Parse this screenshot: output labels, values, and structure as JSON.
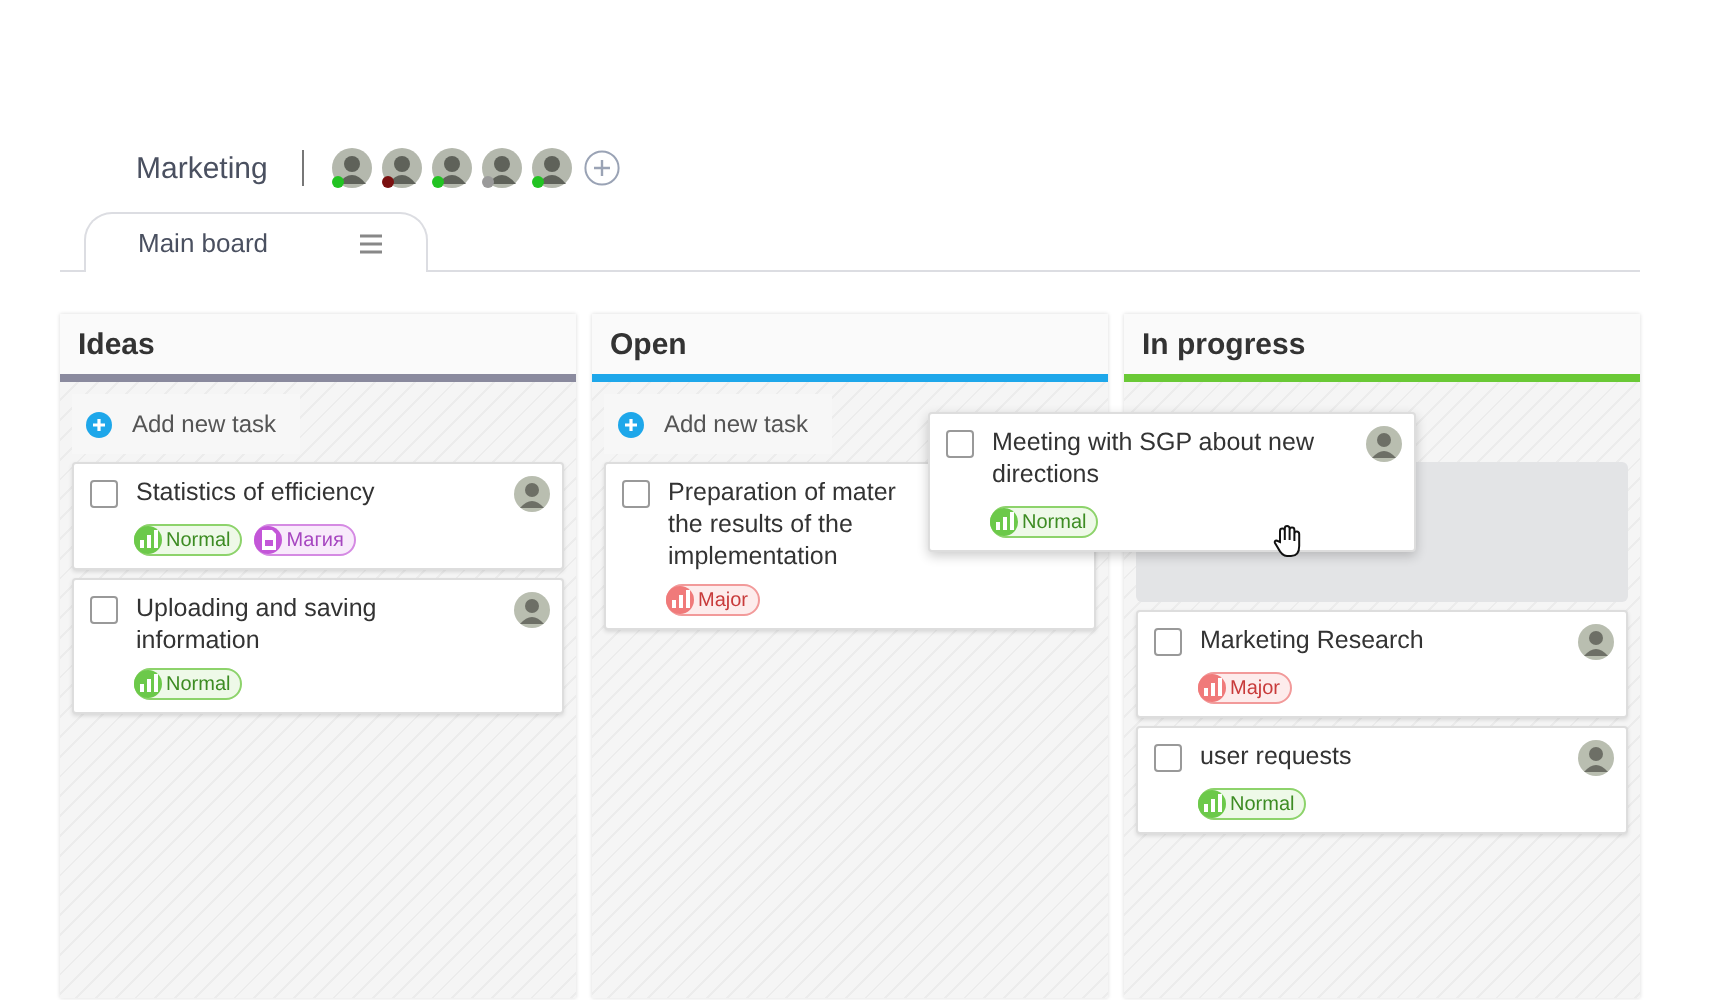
{
  "project": {
    "title": "Marketing",
    "members": [
      {
        "color": "#22c322"
      },
      {
        "color": "#7a1010"
      },
      {
        "color": "#22c322"
      },
      {
        "color": "#9a9a9a"
      },
      {
        "color": "#22c322"
      }
    ]
  },
  "tabs": [
    {
      "label": "Main board",
      "selected": true
    }
  ],
  "columns": [
    {
      "title": "Ideas",
      "color": "#8a8a9e",
      "add_label": "Add new task",
      "items": [
        {
          "kind": "card",
          "title": "Statistics of efficiency",
          "checked": false,
          "tags": [
            {
              "kind": "normal",
              "label": "Normal"
            },
            {
              "kind": "label",
              "label": "Магия"
            }
          ]
        },
        {
          "kind": "card",
          "title": "Uploading and saving information",
          "checked": false,
          "tags": [
            {
              "kind": "normal",
              "label": "Normal"
            }
          ]
        }
      ]
    },
    {
      "title": "Open",
      "color": "#1ea7ea",
      "add_label": "Add new task",
      "items": [
        {
          "kind": "card",
          "title": "Preparation of mater\nthe results of the\nimplementation",
          "checked": false,
          "tags": [
            {
              "kind": "major",
              "label": "Major"
            }
          ]
        }
      ]
    },
    {
      "title": "In progress",
      "color": "#6ac936",
      "items": [
        {
          "kind": "drop_zone"
        },
        {
          "kind": "card",
          "title": "Marketing Research",
          "checked": false,
          "tags": [
            {
              "kind": "major",
              "label": "Major"
            }
          ]
        },
        {
          "kind": "card",
          "title": "user requests",
          "checked": false,
          "tags": [
            {
              "kind": "normal",
              "label": "Normal"
            }
          ]
        }
      ]
    }
  ],
  "dragged_card": {
    "title": "Meeting with SGP about new directions",
    "checked": false,
    "tags": [
      {
        "kind": "normal",
        "label": "Normal"
      }
    ]
  }
}
